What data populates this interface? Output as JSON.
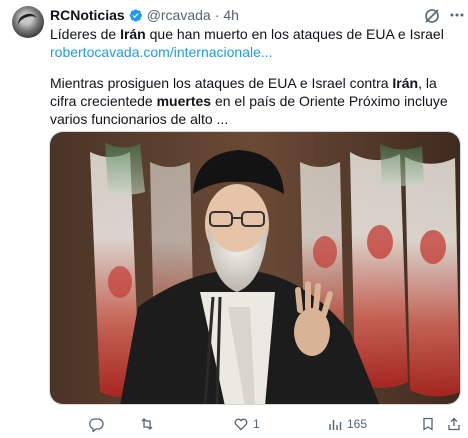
{
  "tweet": {
    "author_name": "RCNoticias",
    "handle": "@rcavada",
    "separator": "·",
    "time": "4h",
    "line1_pre": "Líderes de ",
    "line1_bold": "Irán",
    "line1_post": " que han muerto en los ataques de EUA e Israel",
    "link": "robertocavada.com/internacionale...",
    "body_pre": "Mientras prosiguen los ataques de EUA e Israel contra ",
    "body_bold1": "Irán",
    "body_mid": ", la cifra crecientede ",
    "body_bold2": "muertes",
    "body_post": " en el país de Oriente Próximo incluye varios funcionarios de alto ..."
  },
  "actions": {
    "reply_count": "",
    "retweet_count": "",
    "like_count": "1",
    "views_count": "165"
  },
  "colors": {
    "link": "#1d9bf0",
    "verified": "#1d9bf0",
    "muted": "#536471",
    "text": "#0f1419"
  },
  "icons": [
    "verified-badge-icon",
    "grok-icon",
    "more-icon",
    "reply-icon",
    "retweet-icon",
    "like-icon",
    "views-icon",
    "bookmark-icon",
    "share-icon"
  ]
}
